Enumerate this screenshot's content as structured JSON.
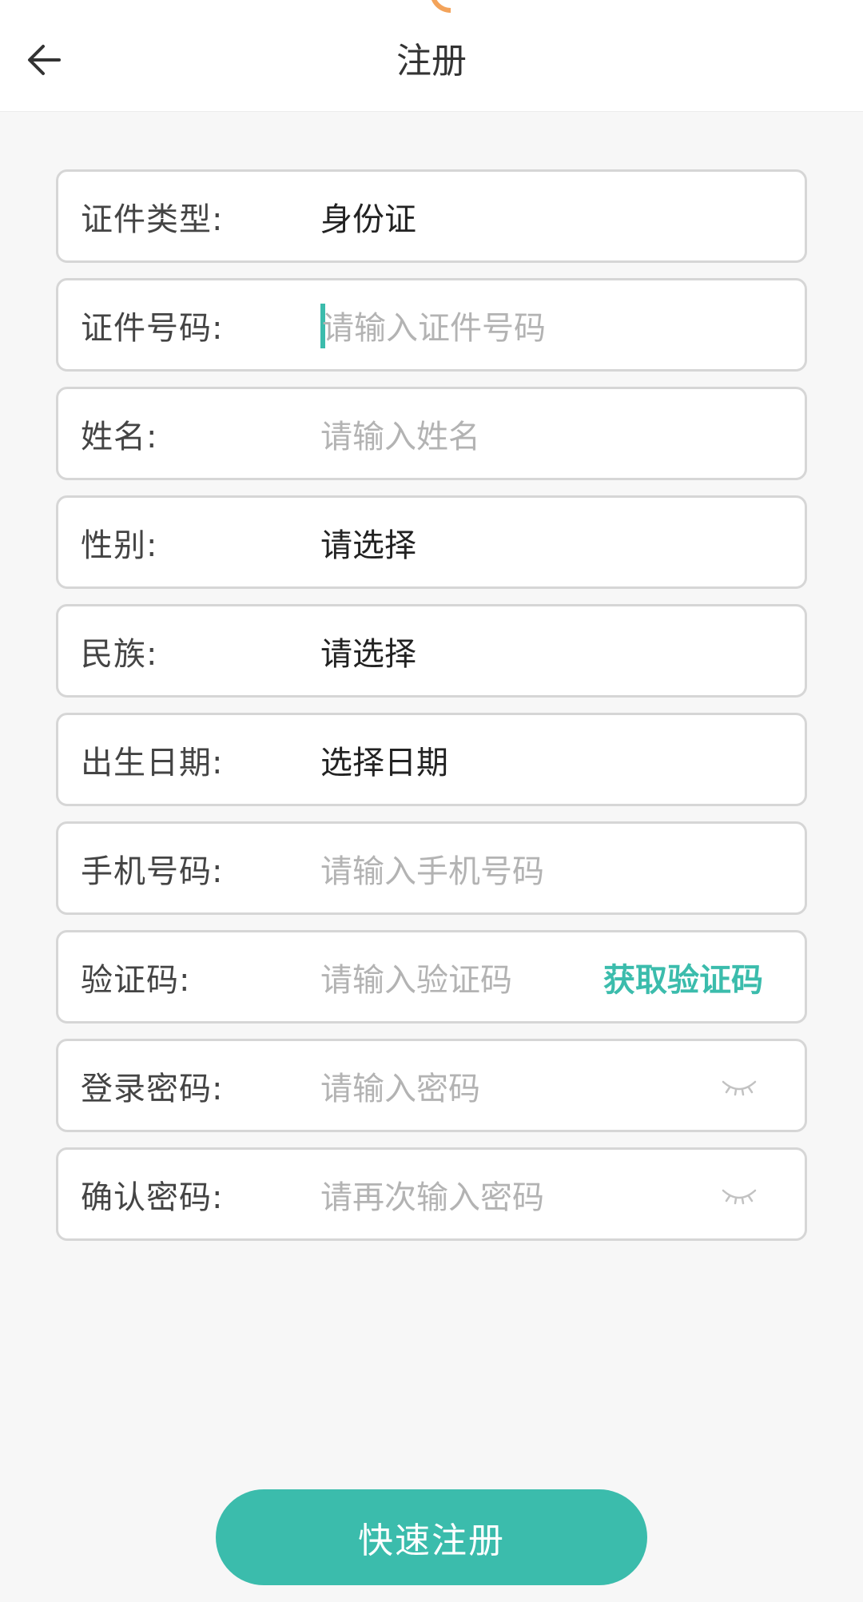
{
  "header": {
    "title": "注册",
    "back_icon": "arrow-left-icon"
  },
  "form": {
    "id_type": {
      "label": "证件类型:",
      "value": "身份证"
    },
    "id_number": {
      "label": "证件号码:",
      "placeholder": "请输入证件号码"
    },
    "name": {
      "label": "姓名:",
      "placeholder": "请输入姓名"
    },
    "gender": {
      "label": "性别:",
      "value": "请选择"
    },
    "ethnicity": {
      "label": "民族:",
      "value": "请选择"
    },
    "birth_date": {
      "label": "出生日期:",
      "value": "选择日期"
    },
    "phone": {
      "label": "手机号码:",
      "placeholder": "请输入手机号码"
    },
    "verify_code": {
      "label": "验证码:",
      "placeholder": "请输入验证码",
      "button": "获取验证码"
    },
    "password": {
      "label": "登录密码:",
      "placeholder": "请输入密码",
      "toggle_icon": "eye-closed-icon"
    },
    "confirm_password": {
      "label": "确认密码:",
      "placeholder": "请再次输入密码",
      "toggle_icon": "eye-closed-icon"
    }
  },
  "submit": {
    "label": "快速注册"
  },
  "colors": {
    "accent": "#3bbcac",
    "placeholder": "#b3b3b3",
    "border": "#d6d6d6",
    "background": "#f7f7f7"
  }
}
